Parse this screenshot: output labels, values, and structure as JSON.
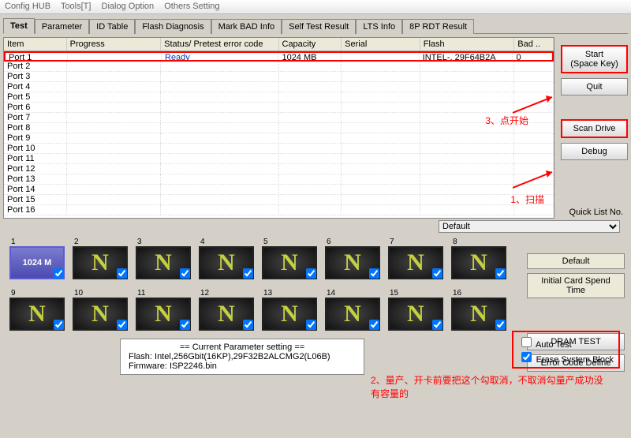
{
  "menu": {
    "config": "Config HUB",
    "tools": "Tools[T]",
    "dialog": "Dialog Option",
    "others": "Others Setting"
  },
  "tabs": [
    "Test",
    "Parameter",
    "ID Table",
    "Flash Diagnosis",
    "Mark BAD Info",
    "Self Test Result",
    "LTS Info",
    "8P RDT Result"
  ],
  "active_tab": 0,
  "grid": {
    "headers": [
      "Item",
      "Progress",
      "Status/ Pretest error code",
      "Capacity",
      "Serial",
      "Flash",
      "Bad .."
    ],
    "rows": [
      {
        "item": "Port 1",
        "progress": "",
        "status": "Ready",
        "capacity": "1024 MB",
        "serial": "",
        "flash": "INTEL-, 29F64B2A",
        "bad": "0"
      },
      {
        "item": "Port 2"
      },
      {
        "item": "Port 3"
      },
      {
        "item": "Port 4"
      },
      {
        "item": "Port 5"
      },
      {
        "item": "Port 6"
      },
      {
        "item": "Port 7"
      },
      {
        "item": "Port 8"
      },
      {
        "item": "Port 9"
      },
      {
        "item": "Port 10"
      },
      {
        "item": "Port 11"
      },
      {
        "item": "Port 12"
      },
      {
        "item": "Port 13"
      },
      {
        "item": "Port 14"
      },
      {
        "item": "Port 15"
      },
      {
        "item": "Port 16"
      }
    ]
  },
  "side": {
    "start1": "Start",
    "start2": "(Space Key)",
    "quit": "Quit",
    "scan": "Scan Drive",
    "debug": "Debug",
    "qlist": "Quick List No."
  },
  "default_select": "Default",
  "cards": {
    "count": 16,
    "selected": 1,
    "cap_text": "1024 M"
  },
  "right": {
    "default": "Default",
    "spend": "Initial Card Spend Time",
    "dram": "DRAM TEST",
    "err": "Error Code Define"
  },
  "param": {
    "title": "== Current Parameter setting ==",
    "flash": "Flash:   Intel,256Gbit(16KP),29F32B2ALCMG2(L06B)",
    "fw": "Firmware:   ISP2246.bin"
  },
  "checks": {
    "auto": "Auto Test",
    "erase": "Erase System Block",
    "erase_checked": true,
    "auto_checked": false
  },
  "annots": {
    "a1": "1、扫描",
    "a2": "2、量产、开卡前要把这个勾取消，不取消勾量产成功没有容量的",
    "a3": "3、点开始"
  }
}
